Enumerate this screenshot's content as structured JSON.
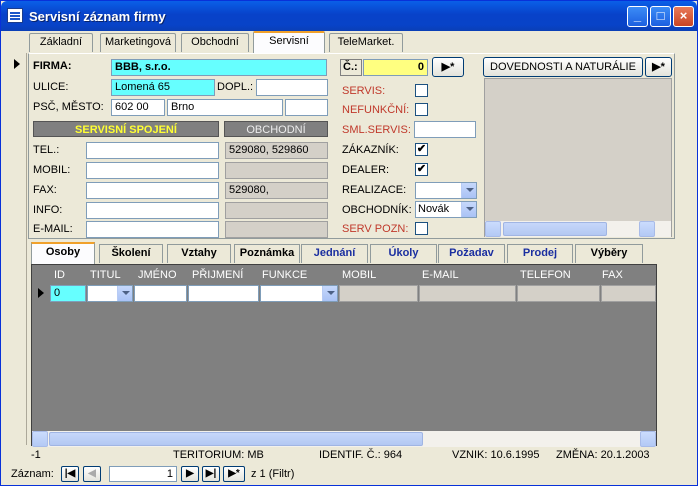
{
  "window": {
    "title": "Servisní záznam firmy"
  },
  "tabs": [
    {
      "label": "Základní"
    },
    {
      "label": "Marketingová"
    },
    {
      "label": "Obchodní"
    },
    {
      "label": "Servisní"
    },
    {
      "label": "TeleMarket."
    }
  ],
  "form": {
    "firma_label": "FIRMA:",
    "firma_value": "BBB, s.r.o.",
    "cislo_label": "Č.:",
    "cislo_value": "0",
    "ulice_label": "ULICE:",
    "ulice_value": "Lomená 65",
    "dopl_label": "DOPL.:",
    "dopl_value": "",
    "psc_label": "PSČ, MĚSTO:",
    "psc_value": "602 00",
    "mesto_value": "Brno",
    "servisni_spojeni_header": "SERVISNÍ SPOJENÍ",
    "obchodni_header": "OBCHODNÍ",
    "tel_label": "TEL.:",
    "tel_obchodni": "529080, 529860",
    "mobil_label": "MOBIL:",
    "fax_label": "FAX:",
    "fax_obchodni": "529080,",
    "info_label": "INFO:",
    "email_label": "E-MAIL:",
    "servis_label": "SERVIS:",
    "nefunkcni_label": "NEFUNKČNÍ:",
    "sml_servis_label": "SML.SERVIS:",
    "zakaznik_label": "ZÁKAZNÍK:",
    "dealer_label": "DEALER:",
    "realizace_label": "REALIZACE:",
    "obchodnik_label": "OBCHODNÍK:",
    "obchodnik_value": "Novák",
    "serv_pozn_label": "SERV POZN:",
    "checkmark": "✔",
    "dovednosti_label": "DOVEDNOSTI A NATURÁLIE",
    "new_record_symbol": "▶*"
  },
  "subtabs": [
    {
      "label": "Osoby"
    },
    {
      "label": "Školení"
    },
    {
      "label": "Vztahy"
    },
    {
      "label": "Poznámka"
    },
    {
      "label": "Jednání"
    },
    {
      "label": "Úkoly"
    },
    {
      "label": "Požadav"
    },
    {
      "label": "Prodej"
    },
    {
      "label": "Výběry"
    }
  ],
  "grid": {
    "columns": [
      "ID",
      "TITUL",
      "JMÉNO",
      "PŘIJMENÍ",
      "FUNKCE",
      "MOBIL",
      "E-MAIL",
      "TELEFON",
      "FAX"
    ],
    "row_id": "0"
  },
  "status": {
    "left": "-1",
    "teritorium": "TERITORIUM: MB",
    "identif": "IDENTIF. Č.:  964",
    "vznik": "VZNIK: 10.6.1995",
    "zmena": "ZMĚNA: 20.1.2003"
  },
  "nav": {
    "label": "Záznam:",
    "current": "1",
    "of_text": "z  1 (Filtr)"
  },
  "colors": {
    "accent_cyan": "#66ffff",
    "accent_yellow": "#ffff80",
    "header_yellow": "#ffff33",
    "title_blue": "#0842c9"
  }
}
